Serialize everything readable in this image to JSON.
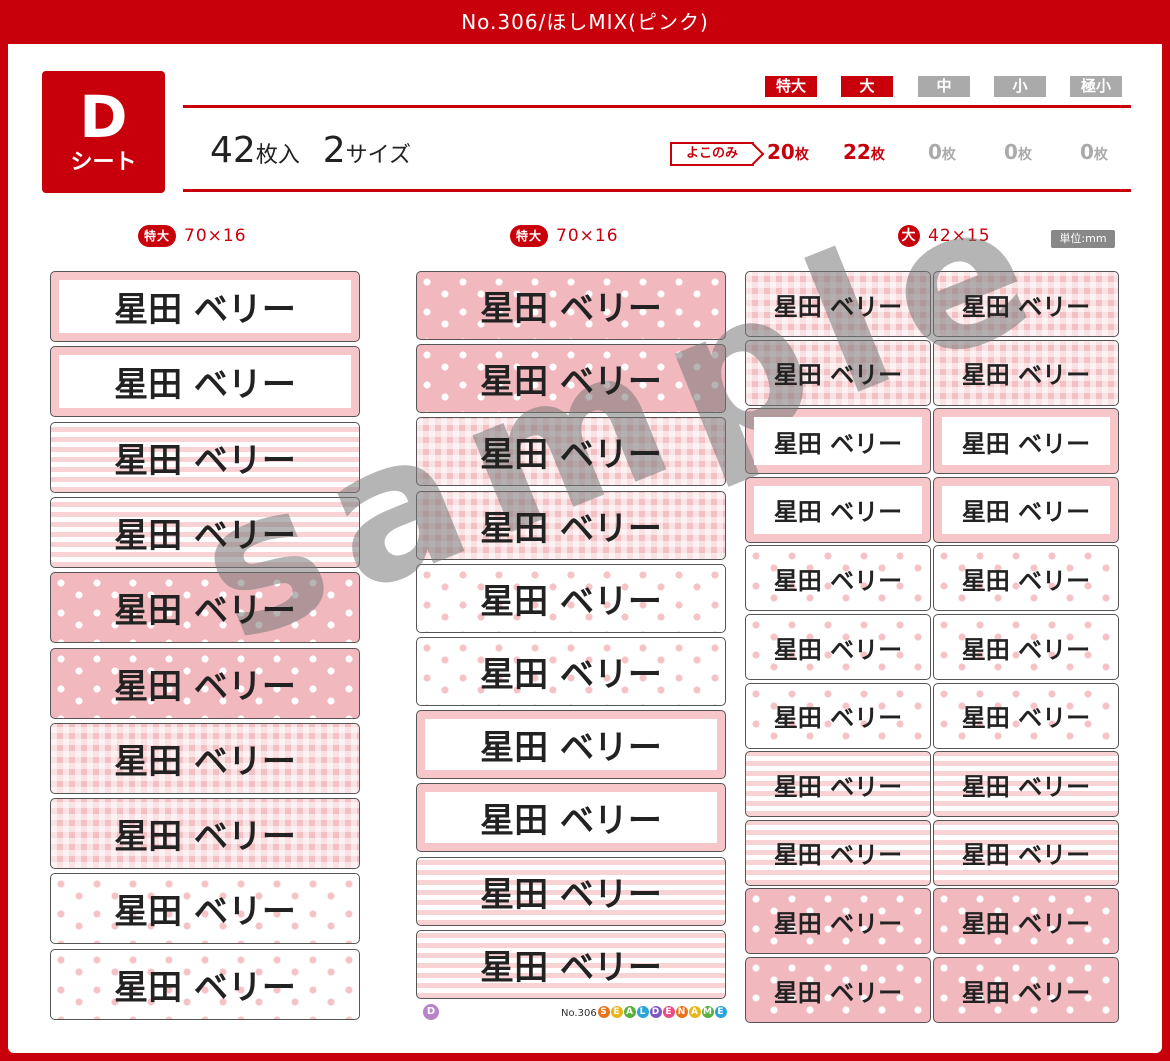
{
  "title": "No.306/ほしMIX(ピンク)",
  "sheet": {
    "letter": "D",
    "label": "シート"
  },
  "summary": {
    "count_num": "42",
    "count_unit": "枚入",
    "sizes_num": "2",
    "sizes_unit": "サイズ"
  },
  "sizes": [
    {
      "label": "特大",
      "color": "#c8000b",
      "count": "20",
      "unit": "枚",
      "count_color": "#c8000b"
    },
    {
      "label": "大",
      "color": "#c8000b",
      "count": "22",
      "unit": "枚",
      "count_color": "#c8000b"
    },
    {
      "label": "中",
      "color": "#aaaaaa",
      "count": "0",
      "unit": "枚",
      "count_color": "#aaaaaa"
    },
    {
      "label": "小",
      "color": "#aaaaaa",
      "count": "0",
      "unit": "枚",
      "count_color": "#aaaaaa"
    },
    {
      "label": "極小",
      "color": "#aaaaaa",
      "count": "0",
      "unit": "枚",
      "count_color": "#aaaaaa"
    }
  ],
  "yoko_label": "よこのみ",
  "columns": [
    {
      "badge": "特大",
      "dims": "70×16"
    },
    {
      "badge": "特大",
      "dims": "70×16"
    },
    {
      "badge": "大",
      "dims": "42×15"
    }
  ],
  "unit_label": "単位:mm",
  "name_text": "星田 ベリー",
  "col1_patterns": [
    "plain",
    "plain",
    "stripe",
    "stripe",
    "starpink",
    "starpink",
    "check",
    "check",
    "starwhite",
    "starwhite"
  ],
  "col2_patterns": [
    "starpink",
    "starpink",
    "check",
    "check",
    "starwhite",
    "starwhite",
    "plain",
    "plain",
    "stripe",
    "stripe"
  ],
  "col3_patterns": [
    "check",
    "check",
    "plain",
    "plain",
    "starwhite",
    "starwhite",
    "starwhite",
    "stripe",
    "stripe",
    "starpink",
    "starpink"
  ],
  "watermark": "sample",
  "footer": {
    "d_badge": "D",
    "number": "No.306",
    "brand": "SEALDENAME"
  }
}
